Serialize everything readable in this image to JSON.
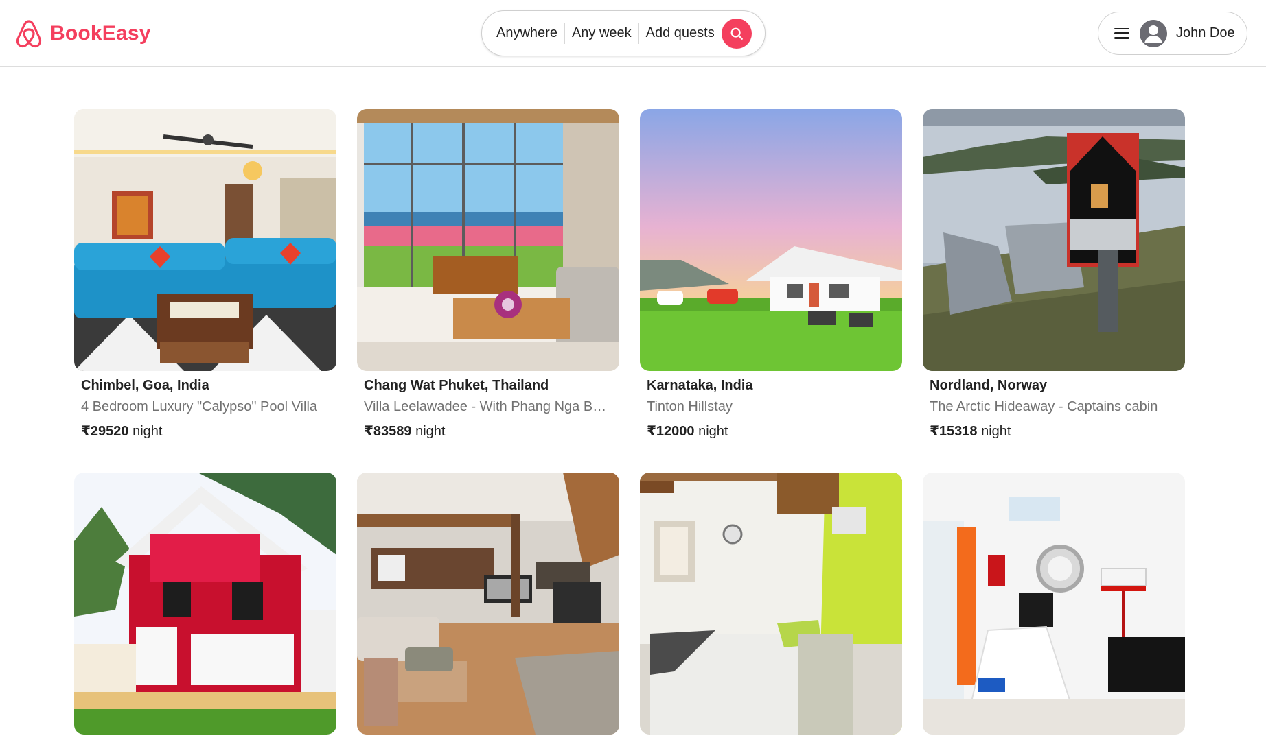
{
  "app": {
    "name": "BookEasy",
    "accent_color": "#f43f5e"
  },
  "search": {
    "where": "Anywhere",
    "when": "Any week",
    "who": "Add quests",
    "button_icon": "search-icon"
  },
  "user": {
    "menu_icon": "hamburger-menu-icon",
    "avatar_icon": "user-avatar-icon",
    "name": "John Doe"
  },
  "listings": [
    {
      "location": "Chimbel, Goa, India",
      "title": "4 Bedroom Luxury \"Calypso\" Pool Villa",
      "price": "₹29520",
      "price_unit": "night",
      "image": "living-room-blue-sofas"
    },
    {
      "location": "Chang Wat Phuket, Thailand",
      "title": "Villa Leelawadee - With Phang Nga Bay View",
      "price": "₹83589",
      "price_unit": "night",
      "image": "sea-view-living-room"
    },
    {
      "location": "Karnataka, India",
      "title": "Tinton Hillstay",
      "price": "₹12000",
      "price_unit": "night",
      "image": "white-cottage-on-hill"
    },
    {
      "location": "Nordland, Norway",
      "title": "The Arctic Hideaway - Captains cabin",
      "price": "₹15318",
      "price_unit": "night",
      "image": "black-cabin-by-fjord"
    },
    {
      "location": "",
      "title": "",
      "price": "",
      "price_unit": "",
      "image": "red-cabin"
    },
    {
      "location": "",
      "title": "",
      "price": "",
      "price_unit": "",
      "image": "wooden-lodge-living-room"
    },
    {
      "location": "",
      "title": "",
      "price": "",
      "price_unit": "",
      "image": "green-wall-bedroom"
    },
    {
      "location": "",
      "title": "",
      "price": "",
      "price_unit": "",
      "image": "white-dining-room"
    }
  ]
}
